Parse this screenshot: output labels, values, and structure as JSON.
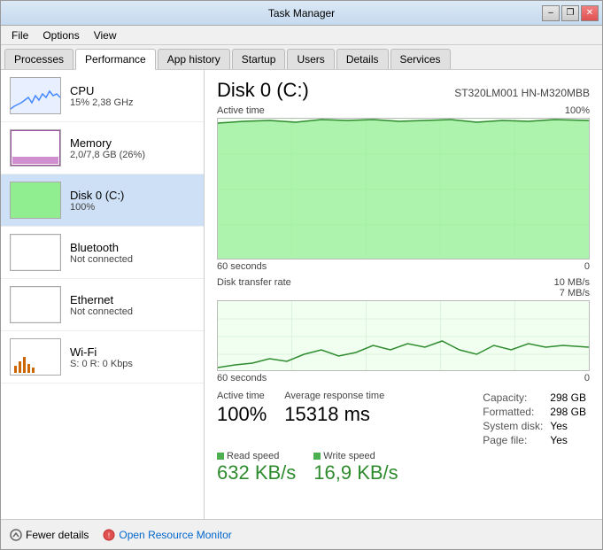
{
  "window": {
    "title": "Task Manager",
    "controls": {
      "minimize": "–",
      "maximize": "❐",
      "close": "✕"
    }
  },
  "menu": {
    "items": [
      "File",
      "Options",
      "View"
    ]
  },
  "tabs": [
    {
      "id": "processes",
      "label": "Processes"
    },
    {
      "id": "performance",
      "label": "Performance",
      "active": true
    },
    {
      "id": "app-history",
      "label": "App history"
    },
    {
      "id": "startup",
      "label": "Startup"
    },
    {
      "id": "users",
      "label": "Users"
    },
    {
      "id": "details",
      "label": "Details"
    },
    {
      "id": "services",
      "label": "Services"
    }
  ],
  "sidebar": {
    "items": [
      {
        "id": "cpu",
        "title": "CPU",
        "subtitle": "15% 2,38 GHz",
        "type": "cpu"
      },
      {
        "id": "memory",
        "title": "Memory",
        "subtitle": "2,0/7,8 GB (26%)",
        "type": "memory"
      },
      {
        "id": "disk",
        "title": "Disk 0 (C:)",
        "subtitle": "100%",
        "type": "disk",
        "active": true
      },
      {
        "id": "bluetooth",
        "title": "Bluetooth",
        "subtitle": "Not connected",
        "type": "bluetooth"
      },
      {
        "id": "ethernet",
        "title": "Ethernet",
        "subtitle": "Not connected",
        "type": "ethernet"
      },
      {
        "id": "wifi",
        "title": "Wi-Fi",
        "subtitle": "S: 0  R: 0 Kbps",
        "type": "wifi"
      }
    ]
  },
  "main": {
    "disk_title": "Disk 0 (C:)",
    "disk_model": "ST320LM001 HN-M320MBB",
    "active_time_label": "Active time",
    "active_time_pct": "100%",
    "chart_time_label": "60 seconds",
    "chart_right_label": "0",
    "transfer_label": "Disk transfer rate",
    "transfer_right1": "10 MB/s",
    "transfer_right2": "7 MB/s",
    "transfer_time": "60 seconds",
    "transfer_right_0": "0",
    "stats": {
      "active_time": {
        "label": "Active time",
        "value": "100%"
      },
      "avg_response": {
        "label": "Average response time",
        "value": "15318 ms"
      },
      "read_speed": {
        "label": "Read speed",
        "value": "632 KB/s"
      },
      "write_speed": {
        "label": "Write speed",
        "value": "16,9 KB/s"
      }
    },
    "right_stats": {
      "capacity_label": "Capacity:",
      "capacity_value": "298 GB",
      "formatted_label": "Formatted:",
      "formatted_value": "298 GB",
      "system_label": "System disk:",
      "system_value": "Yes",
      "pagefile_label": "Page file:",
      "pagefile_value": "Yes"
    }
  },
  "footer": {
    "fewer_details": "Fewer details",
    "open_resource_monitor": "Open Resource Monitor"
  }
}
